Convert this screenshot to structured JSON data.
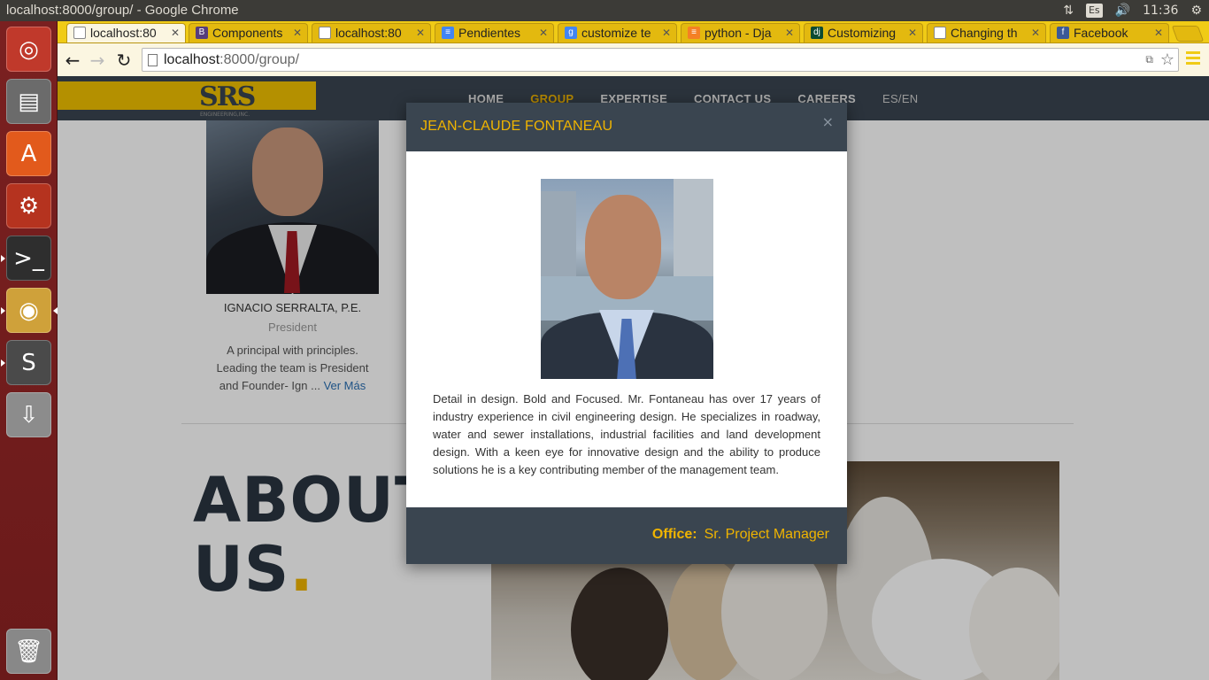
{
  "os": {
    "window_title": "localhost:8000/group/ - Google Chrome",
    "keyboard_layout": "Es",
    "clock": "11:36"
  },
  "launcher": {
    "items": [
      {
        "name": "dash",
        "icon": "ubuntu-logo-icon"
      },
      {
        "name": "files",
        "icon": "file-cabinet-icon"
      },
      {
        "name": "software-center",
        "icon": "shopping-bag-icon"
      },
      {
        "name": "system-settings",
        "icon": "wrench-gear-icon"
      },
      {
        "name": "terminal",
        "icon": "terminal-icon"
      },
      {
        "name": "chrome",
        "icon": "chrome-icon"
      },
      {
        "name": "sublime-text",
        "icon": "sublime-icon"
      },
      {
        "name": "usb-drive",
        "icon": "usb-icon"
      },
      {
        "name": "trash",
        "icon": "trash-icon"
      }
    ]
  },
  "browser": {
    "tabs": [
      {
        "label": "localhost:80",
        "favicon": "page-icon",
        "active": true
      },
      {
        "label": "Components",
        "favicon": "bootstrap-icon"
      },
      {
        "label": "localhost:80",
        "favicon": "page-icon"
      },
      {
        "label": "Pendientes",
        "favicon": "docs-icon"
      },
      {
        "label": "customize te",
        "favicon": "google-icon"
      },
      {
        "label": "python - Dja",
        "favicon": "stackoverflow-icon"
      },
      {
        "label": "Customizing",
        "favicon": "django-icon"
      },
      {
        "label": "Changing th",
        "favicon": "page-icon"
      },
      {
        "label": "Facebook",
        "favicon": "facebook-icon"
      }
    ],
    "url_host": "localhost",
    "url_path": ":8000/group/"
  },
  "site": {
    "nav": {
      "logo_text": "SRS",
      "logo_sub": "ENGINEERING,INC.",
      "items": [
        "HOME",
        "GROUP",
        "EXPERTISE",
        "CONTACT US",
        "CAREERS",
        "ES/EN"
      ]
    },
    "person": {
      "name": "IGNACIO SERRALTA, P.E.",
      "role": "President",
      "desc": "A principal with principles. Leading the team is President and Founder- Ign ...",
      "more": "Ver Más"
    },
    "about_line1": "ABOUT",
    "about_line2": "US",
    "about_dot": "."
  },
  "modal": {
    "title": "JEAN-CLAUDE FONTANEAU",
    "close": "×",
    "text": "Detail in design. Bold and Focused. Mr. Fontaneau has over 17 years of industry experience in civil engineering design. He specializes in roadway, water and sewer installations, industrial facilities and land development design. With a keen eye for innovative design and the ability to produce solutions he is a key contributing member of the management team.",
    "office_label": "Office:",
    "office_value": "Sr. Project Manager"
  },
  "colors": {
    "accent": "#f0b400",
    "navy": "#3a4550",
    "chrome_theme": "#f0cb16",
    "launcher": "#7a2020"
  }
}
